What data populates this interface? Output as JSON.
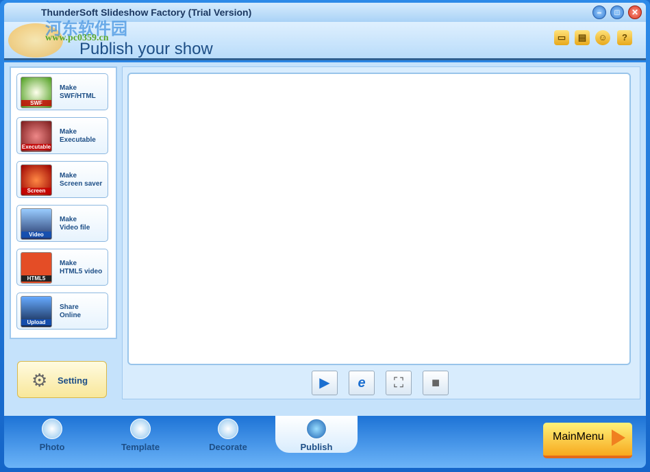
{
  "window": {
    "title": "ThunderSoft Slideshow Factory (Trial Version)",
    "controls": [
      "minimize",
      "maximize",
      "close"
    ]
  },
  "watermark": {
    "cn": "河东软件园",
    "url": "www.pc0359.cn"
  },
  "header": {
    "title": "Publish your show",
    "icons": [
      "folder-icon",
      "save-icon",
      "user-icon",
      "help-icon"
    ]
  },
  "publish_options": [
    {
      "label": "Make\nSWF/HTML",
      "badge": "SWF"
    },
    {
      "label": "Make\nExecutable",
      "badge": "Executable"
    },
    {
      "label": "Make\nScreen saver",
      "badge": "Screen"
    },
    {
      "label": "Make\nVideo file",
      "badge": "Video"
    },
    {
      "label": "Make\nHTML5 video",
      "badge": "HTML5"
    },
    {
      "label": "Share\nOnline",
      "badge": "Upload"
    }
  ],
  "setting": {
    "label": "Setting"
  },
  "player": {
    "controls": [
      "play",
      "browser",
      "fullscreen",
      "stop"
    ]
  },
  "tabs": [
    {
      "label": "Photo"
    },
    {
      "label": "Template"
    },
    {
      "label": "Decorate"
    },
    {
      "label": "Publish",
      "active": true
    }
  ],
  "mainmenu": {
    "label": "MainMenu"
  }
}
